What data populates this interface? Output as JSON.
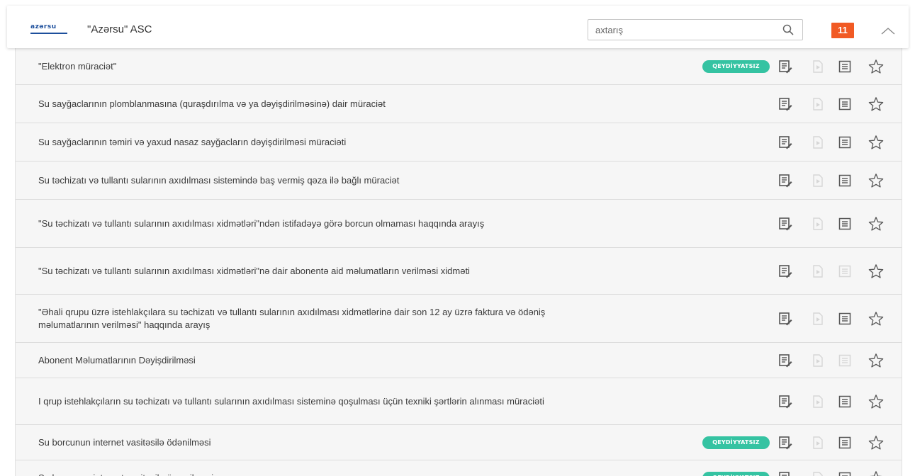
{
  "header": {
    "logo_text": "azərsu",
    "org_title": "\"Azərsu\" ASC",
    "search": {
      "placeholder": "axtarış",
      "value": ""
    },
    "count": "11"
  },
  "colors": {
    "accent_badge": "#f15a24",
    "tag": "#35c3a2",
    "icon_active": "#555555",
    "icon_disabled": "#d6d6d6"
  },
  "icons": [
    "search-icon",
    "chevron-up-icon",
    "apply-icon",
    "play-icon",
    "document-list-icon",
    "star-icon"
  ],
  "tag_label": "QEYDİYYATSIZ",
  "services": [
    {
      "label": "\"Elektron müraciət\"",
      "tag": true,
      "info_enabled": true
    },
    {
      "label": "Su sayğaclarının plomblanmasına (quraşdırılma və ya dəyişdirilməsinə) dair müraciət",
      "tag": false,
      "info_enabled": true
    },
    {
      "label": "Su sayğaclarının təmiri və yaxud nasaz sayğacların dəyişdirilməsi müraciəti",
      "tag": false,
      "info_enabled": true
    },
    {
      "label": "Su təchizatı və tullantı sularının axıdılması sistemində baş vermiş qəza ilə bağlı müraciət",
      "tag": false,
      "info_enabled": true
    },
    {
      "label": "\"Su təchizatı və tullantı sularının axıdılması xidmətləri\"ndən istifadəyə görə borcun olmaması haqqında arayış",
      "tag": false,
      "info_enabled": true
    },
    {
      "label": "\"Su təchizatı və tullantı sularının axıdılması xidmətləri\"nə dair abonentə aid məlumatların verilməsi xidməti",
      "tag": false,
      "info_enabled": false
    },
    {
      "label": "\"Əhali qrupu üzrə istehlakçılara su təchizatı və tullantı sularının axıdılması xidmətlərinə dair son 12 ay üzrə faktura və ödəniş məlumatlarının verilməsi\" haqqında arayış",
      "tag": false,
      "info_enabled": true
    },
    {
      "label": "Abonent Məlumatlarının Dəyişdirilməsi",
      "tag": false,
      "info_enabled": false
    },
    {
      "label": "I qrup istehlakçıların su təchizatı və tullantı sularının axıdılması sisteminə qoşulması üçün texniki şərtlərin alınması müraciəti",
      "tag": false,
      "info_enabled": true
    },
    {
      "label": "Su borcunun internet vasitəsilə ödənilməsi",
      "tag": true,
      "info_enabled": true
    },
    {
      "label": "Su borcunun internet vasitəsilə öyrənilməsi",
      "tag": true,
      "info_enabled": true
    }
  ]
}
